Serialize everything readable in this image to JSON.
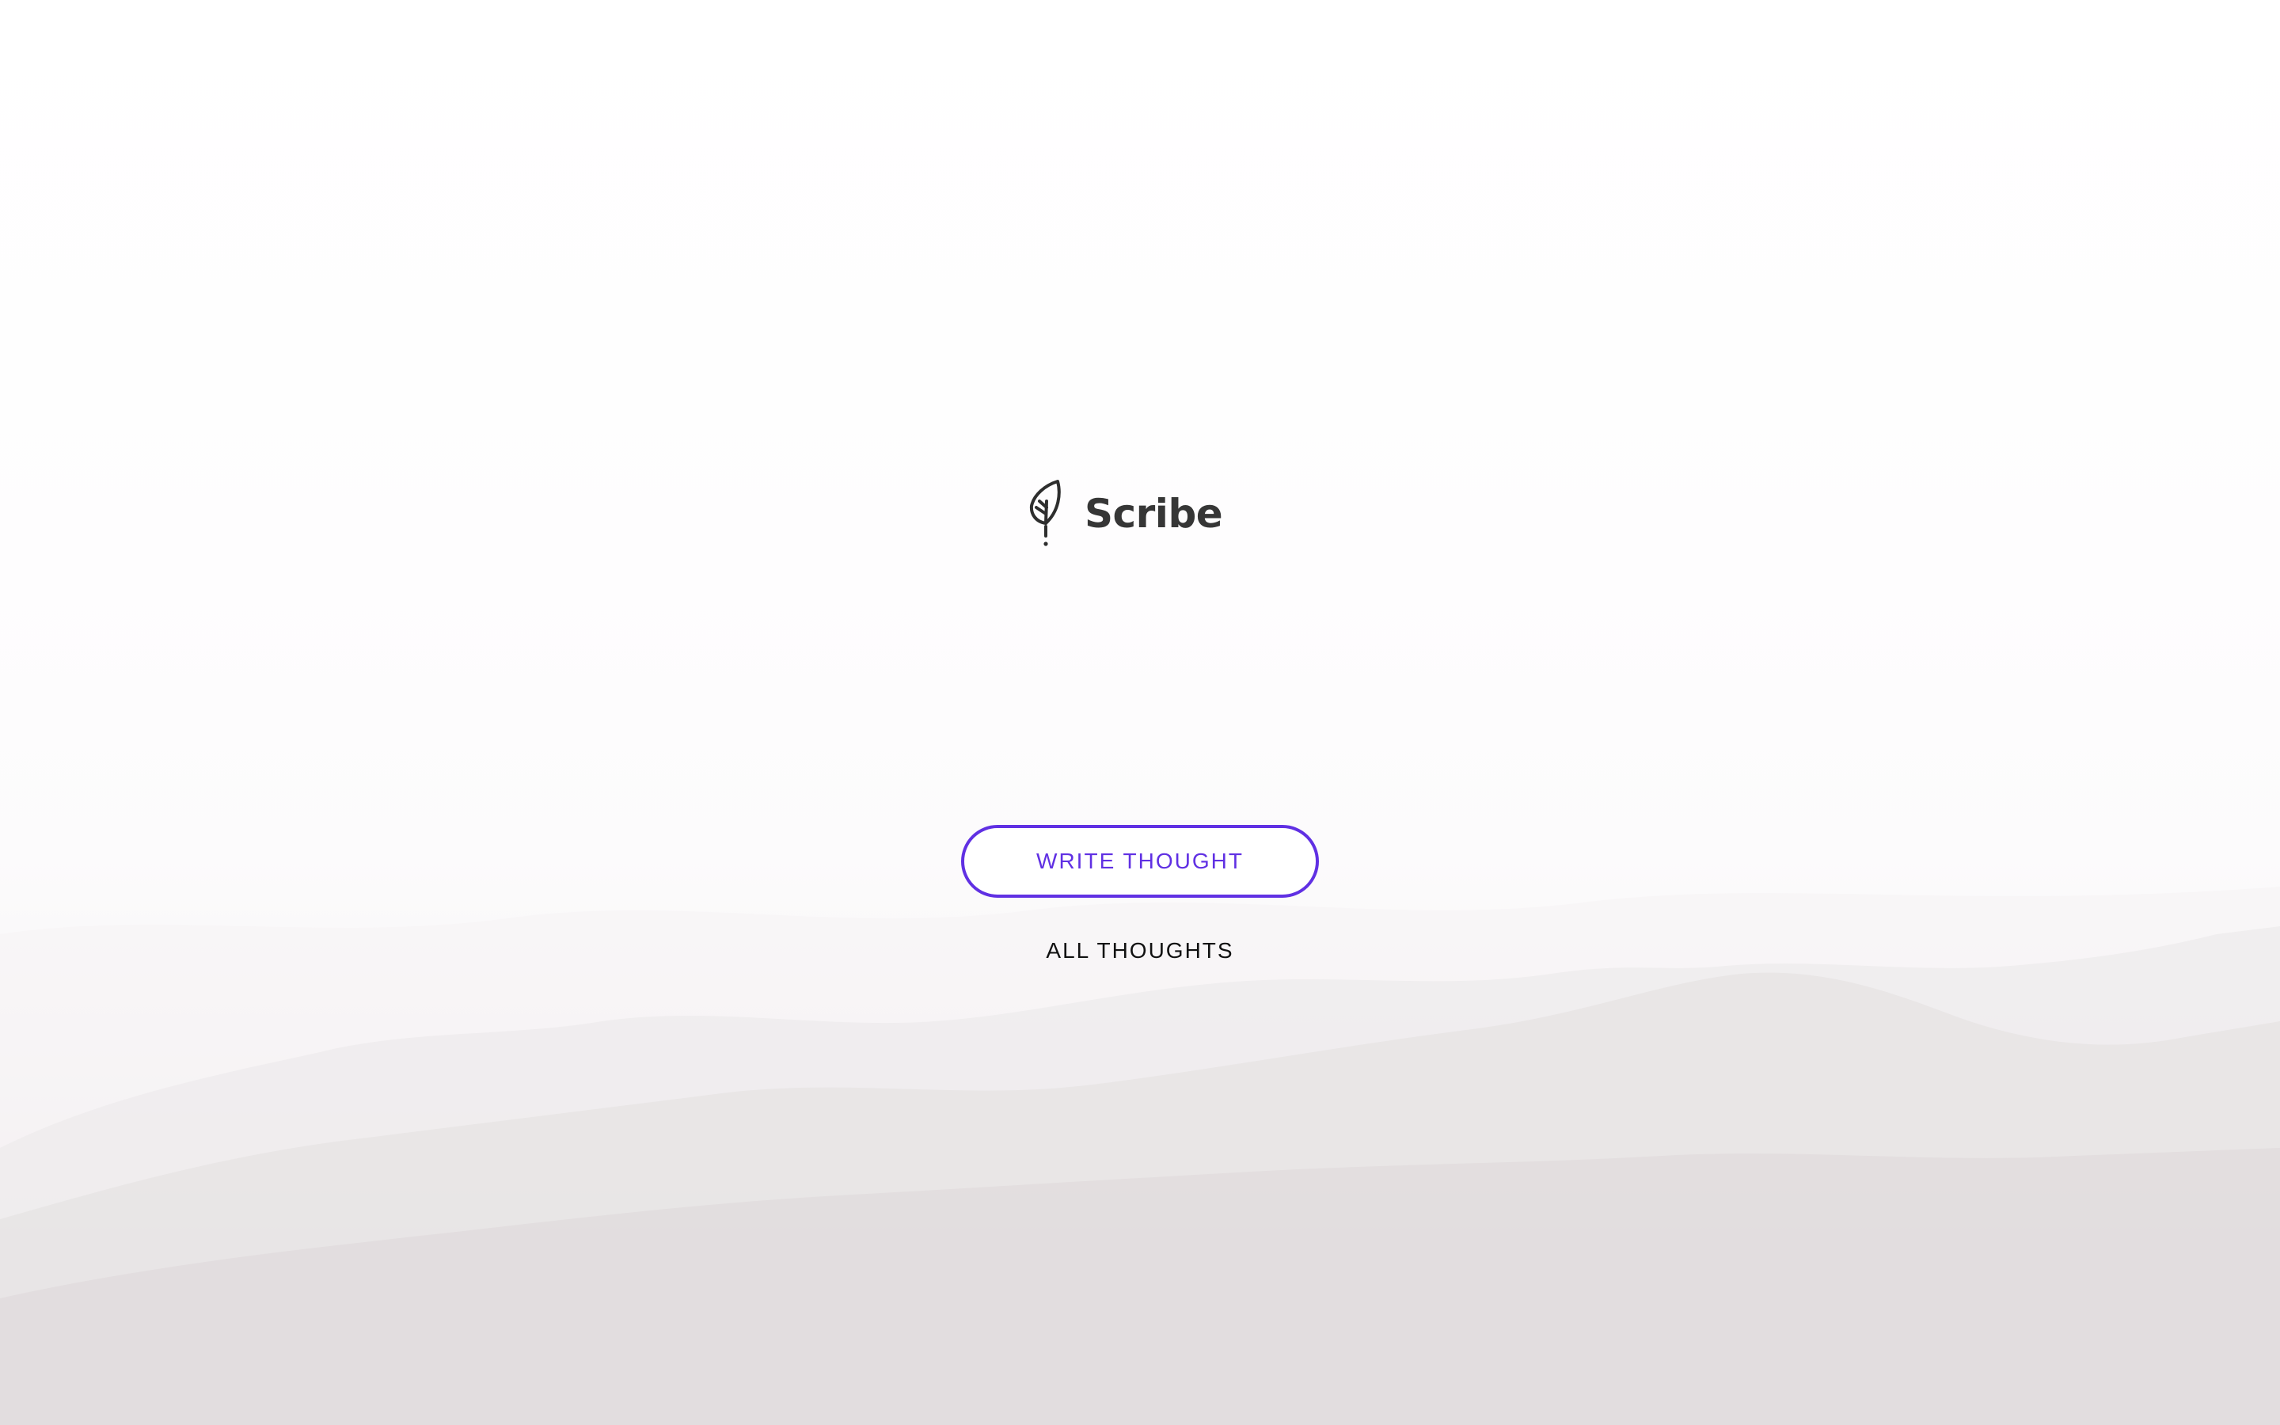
{
  "brand": {
    "name": "Scribe",
    "icon": "feather-icon"
  },
  "actions": {
    "write_label": "WRITE THOUGHT",
    "all_label": "ALL THOUGHTS"
  },
  "colors": {
    "accent": "#6030e3",
    "brand_text": "#363636",
    "link_text": "#111111"
  }
}
